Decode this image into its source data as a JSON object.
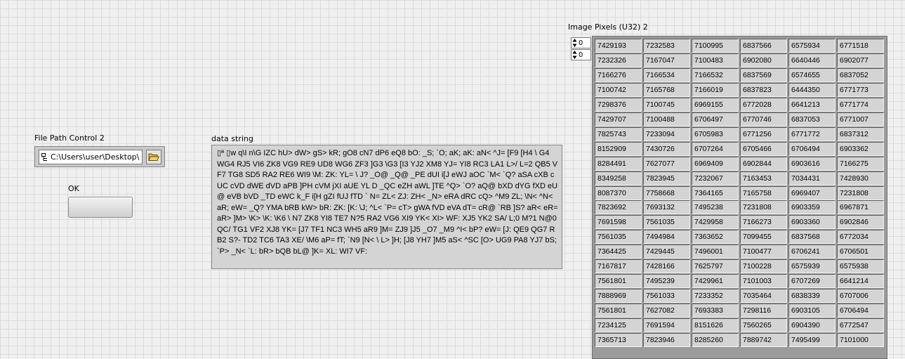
{
  "file_path_control": {
    "label": "File Path Control 2",
    "value": "C:\\Users\\user\\Desktop\\"
  },
  "ok_button": {
    "label": "OK"
  },
  "data_string": {
    "label": "data string",
    "text": "▯ª ▯w q\\I n\\G IZC hU> dW> gS> kR; gO8 cN7 dP6 eQ8 bO: _S; `O; aK; aK: aN< ^J= [F9 [H4 \\ G4 WG4 RJ5 VI6 ZK8 VG9 RE9 UD8 WG6 ZF3 ]G3 \\G3 [I3 YJ2 XM8 YJ= YI8 RC3 LA1 L>/ L=2 QB5 VF7 TG8 SD5 RA2 RE6 WI9 \\M: ZK: YL= \\ J? _O@ _Q@ _PE dUI i[J eWJ aOC `M< `Q? aSA cXB cUC cVD dWE dVD aPB ]PH cVM jXI aUE YL D _QC eZH aWL ]TE ^Q> `O? aQ@ bXD dYG fXD eU@ eVB bVD _TD eWC k_F i[H gZI fUJ fTD ` N= ZL< ZJ: ZH< _N> eRA dRC cQ> ^M9 ZL; \\N< ^N< aR; eW= _Q? YMA bRB kW> bR: ZK: [K: \\J; ^L< `P= cT> gWA fVD eVA dT= cR@ `RB ]S? aR< eR= aR> ]M> \\K> \\K: \\K6 \\ N7 ZK8 YI8 TE7 N?5 RA2 VG6 XI9 YK< XI> WF: XJ5 YK2 SA/ L;0 M?1 N@0 QC/ TG1 VF2 XJ8 YK= [J7 TF1 NC3 WH5 aR9 ]M= ZJ9 ]J5 _O7 _M9 ^I< bP? eW= [J: QE9 QG7 RB2 S?- TD2 TC6 TA3 XE/ \\M6 aP= fT; `N9 [N< \\ L> ]H; [J8 YH7 ]M5 aS< ^SC [O> UG9 PA8 YJ7 bS; `P> _N< `L: bR> bQB bL@ ]K= XL: WI7 VF:"
  },
  "image_pixels": {
    "label": "Image Pixels (U32) 2",
    "row_index": "0",
    "col_index": "0",
    "rows": [
      [
        "7429193",
        "7232583",
        "7100995",
        "6837566",
        "6575934",
        "6771518"
      ],
      [
        "7232326",
        "7167047",
        "7100483",
        "6902080",
        "6640446",
        "6902077"
      ],
      [
        "7166276",
        "7166534",
        "7166532",
        "6837569",
        "6574655",
        "6837052"
      ],
      [
        "7100742",
        "7165768",
        "7166019",
        "6837823",
        "6444350",
        "6771773"
      ],
      [
        "7298376",
        "7100745",
        "6969155",
        "6772028",
        "6641213",
        "6771774"
      ],
      [
        "7429707",
        "7100488",
        "6706497",
        "6770746",
        "6837053",
        "6771007"
      ],
      [
        "7825743",
        "7233094",
        "6705983",
        "6771256",
        "6771772",
        "6837312"
      ],
      [
        "8152909",
        "7430726",
        "6707264",
        "6705466",
        "6706494",
        "6903362"
      ],
      [
        "8284491",
        "7627077",
        "6969409",
        "6902844",
        "6903616",
        "7166275"
      ],
      [
        "8349258",
        "7823945",
        "7232067",
        "7163453",
        "7034431",
        "7428930"
      ],
      [
        "8087370",
        "7758668",
        "7364165",
        "7165758",
        "6969407",
        "7231808"
      ],
      [
        "7823692",
        "7693132",
        "7495238",
        "7231808",
        "6903359",
        "6967871"
      ],
      [
        "7691598",
        "7561035",
        "7429958",
        "7166273",
        "6903360",
        "6902846"
      ],
      [
        "7561035",
        "7494984",
        "7363652",
        "7099455",
        "6837568",
        "6772034"
      ],
      [
        "7364425",
        "7429445",
        "7496001",
        "7100477",
        "6706241",
        "6706501"
      ],
      [
        "7167817",
        "7428166",
        "7625797",
        "7100228",
        "6575939",
        "6575938"
      ],
      [
        "7561801",
        "7495239",
        "7429961",
        "7101003",
        "6707269",
        "6641214"
      ],
      [
        "7888969",
        "7561033",
        "7233352",
        "7035464",
        "6838339",
        "6707006"
      ],
      [
        "7561801",
        "7627082",
        "7693383",
        "7298116",
        "6903105",
        "6706494"
      ],
      [
        "7234125",
        "7691594",
        "8151626",
        "7560265",
        "6904390",
        "6772547"
      ],
      [
        "7365713",
        "7823946",
        "8285260",
        "7889742",
        "7495499",
        "7101000"
      ]
    ]
  }
}
